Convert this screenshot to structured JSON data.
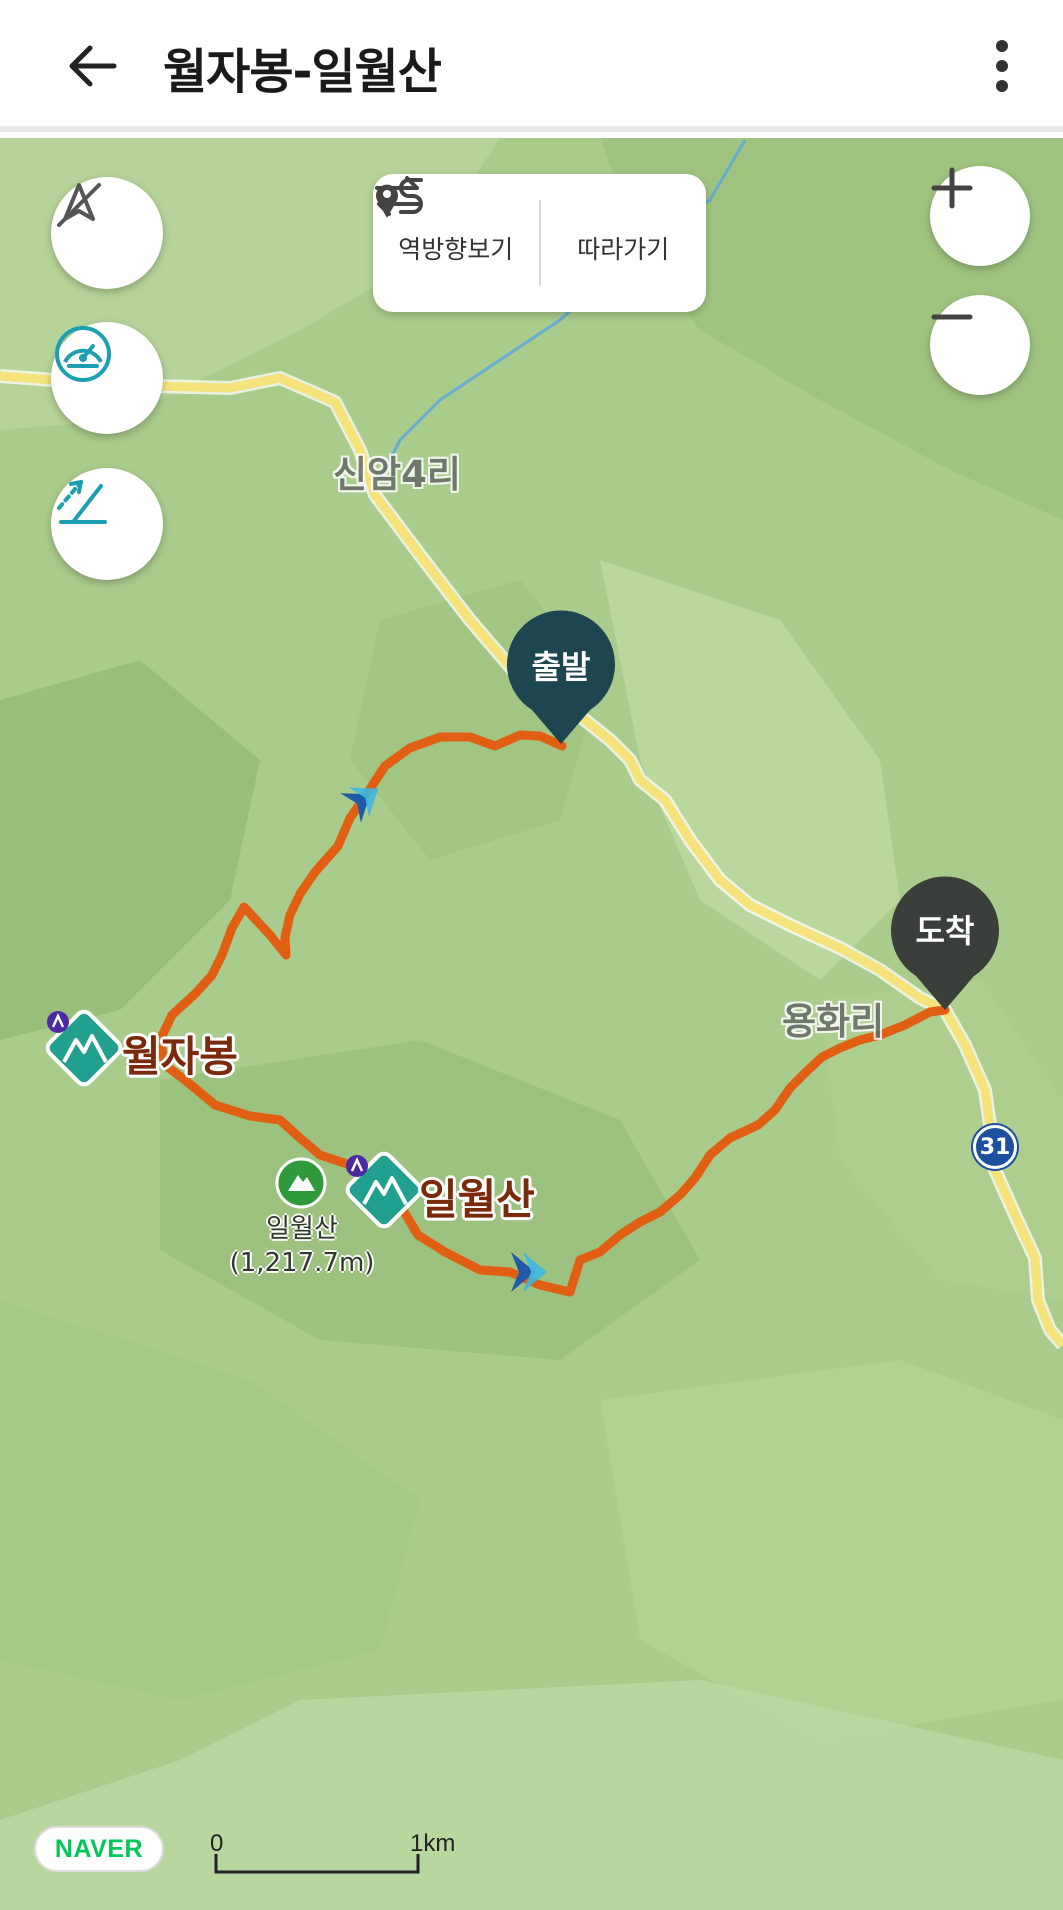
{
  "header": {
    "title": "월자봉-일월산"
  },
  "controls": {
    "reverse_label": "역방향보기",
    "follow_label": "따라가기"
  },
  "map": {
    "places": {
      "village1": "신암4리",
      "village2": "용화리"
    },
    "markers": {
      "start": "출발",
      "end": "도착"
    },
    "peaks": {
      "peak1": "월자봉",
      "peak2": "일월산"
    },
    "summit": {
      "name": "일월산",
      "elevation": "(1,217.7m)"
    },
    "route_number": "31",
    "colors": {
      "route": "#e05f12",
      "road": "#f5e27a",
      "terrain": "#a9cb8b",
      "start_pin": "#1e4650",
      "end_pin": "#3a3f3c"
    }
  },
  "footer": {
    "logo": "NAVER",
    "scale_start": "0",
    "scale_end": "1km"
  }
}
